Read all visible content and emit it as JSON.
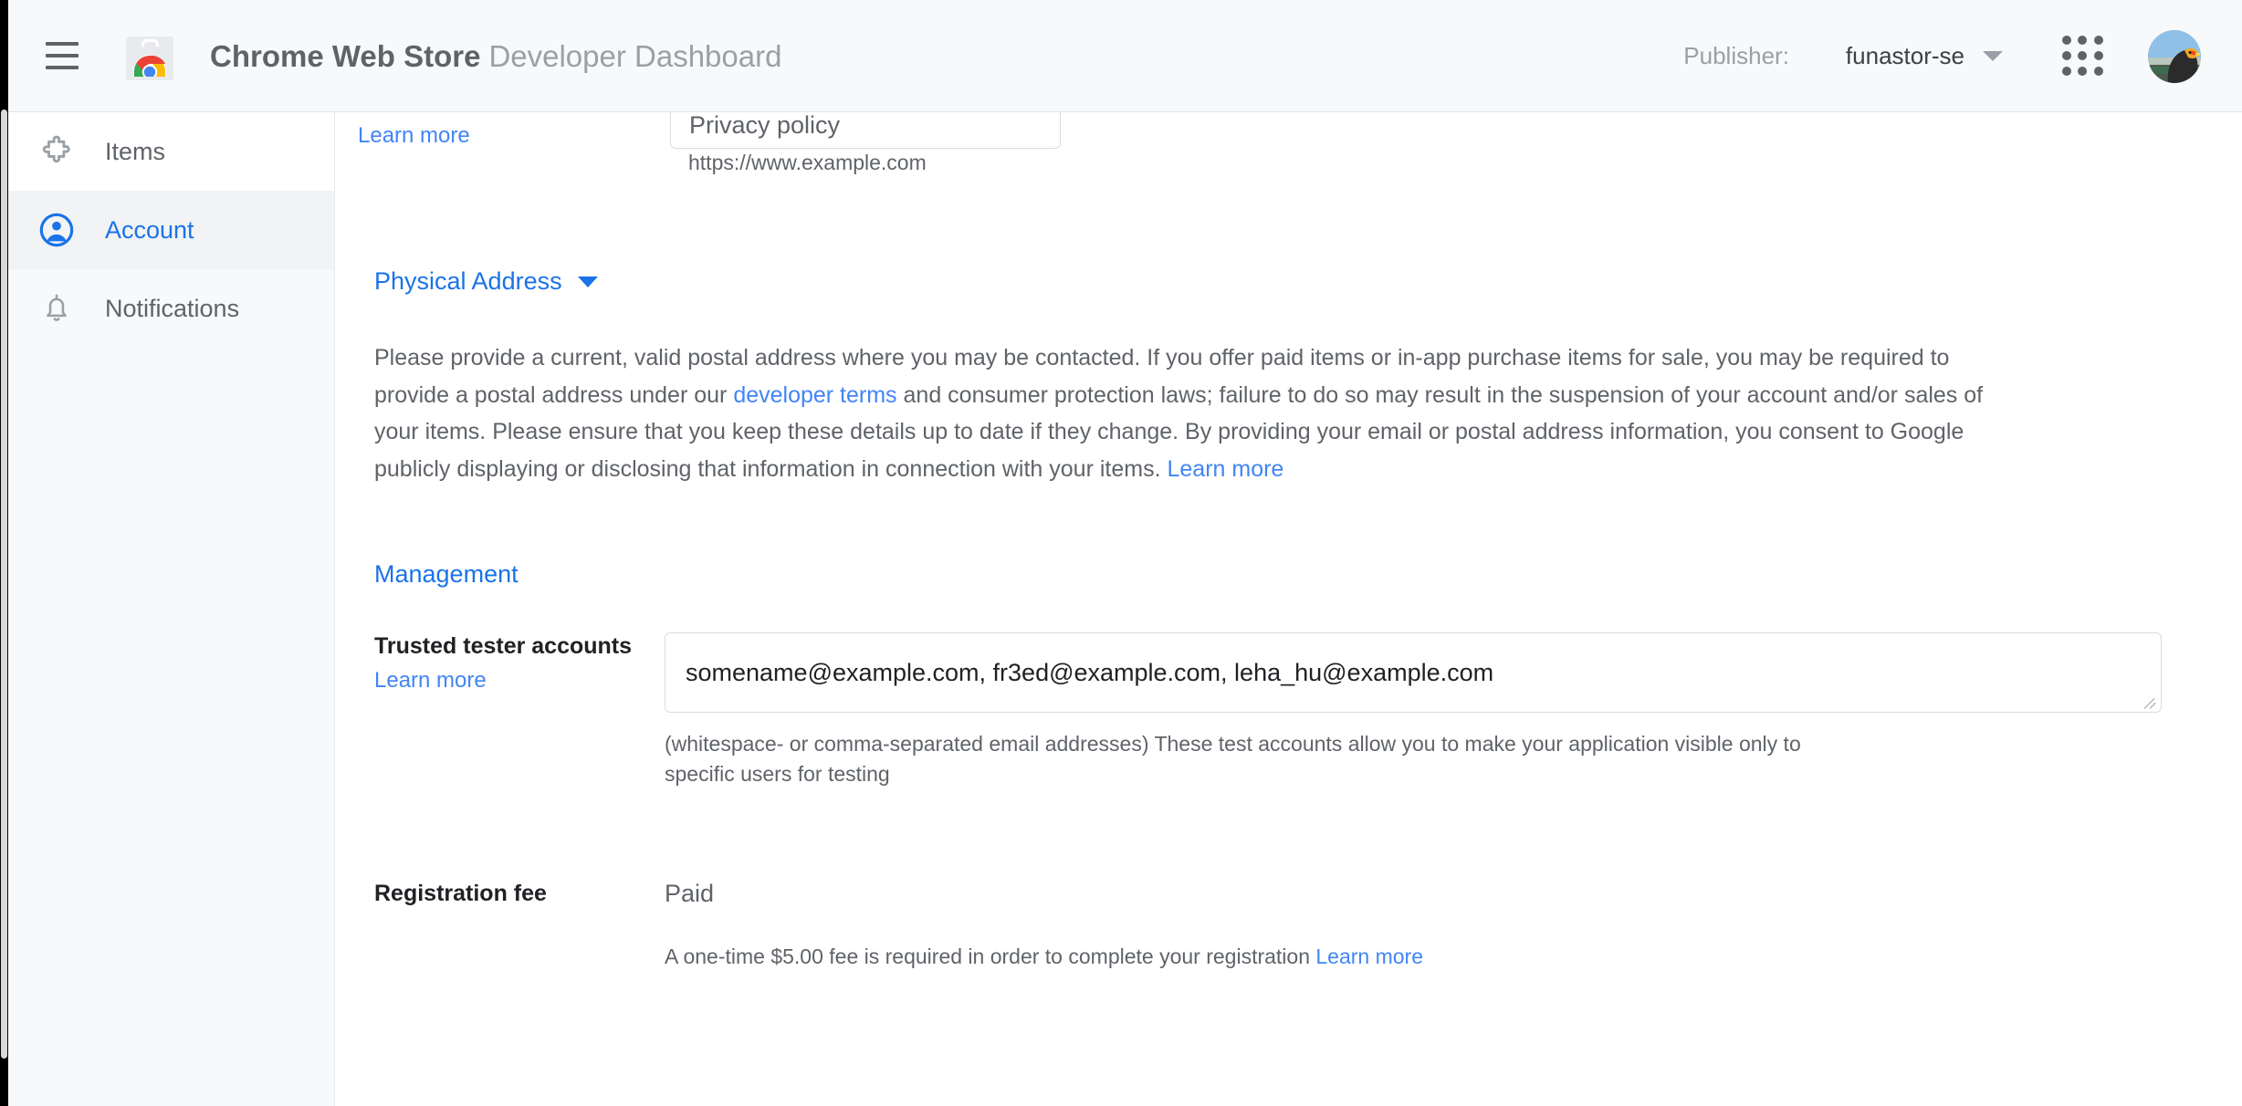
{
  "header": {
    "menu_icon": "hamburger-menu-icon",
    "logo_icon": "chrome-web-store-logo",
    "title_strong": "Chrome Web Store",
    "title_light": "Developer Dashboard",
    "publisher_label": "Publisher:",
    "publisher_value": "funastor-se",
    "publisher_caret_icon": "chevron-down-icon",
    "apps_icon": "google-apps-grid-icon",
    "avatar_icon": "user-avatar-photo"
  },
  "sidebar": {
    "items": [
      {
        "label": "Items",
        "icon": "puzzle-piece-icon",
        "active": false
      },
      {
        "label": "Account",
        "icon": "account-circle-icon",
        "active": true
      },
      {
        "label": "Notifications",
        "icon": "bell-icon",
        "active": false
      }
    ]
  },
  "main": {
    "privacy": {
      "learn_more": "Learn more",
      "field_label": "Privacy policy",
      "field_value": "",
      "hint": "https://www.example.com"
    },
    "physical_address": {
      "heading": "Physical Address",
      "caret_icon": "triangle-down-icon",
      "paragraph_part1": "Please provide a current, valid postal address where you may be contacted. If you offer paid items or in-app purchase items for sale, you may be required to provide a postal address under our ",
      "paragraph_link": "developer terms",
      "paragraph_part2": " and consumer protection laws; failure to do so may result in the suspension of your account and/or sales of your items. Please ensure that you keep these details up to date if they change. By providing your email or postal address information, you consent to Google publicly displaying or disclosing that information in connection with your items. ",
      "paragraph_learn_more": "Learn more"
    },
    "management": {
      "heading": "Management",
      "trusted_testers": {
        "label": "Trusted tester accounts",
        "learn_more": "Learn more",
        "value": "somename@example.com, fr3ed@example.com, leha_hu@example.com",
        "placeholder": "",
        "helper": "(whitespace- or comma-separated email addresses) These test accounts allow you to make your application visible only to specific users for testing",
        "resize_icon": "resize-handle-icon"
      },
      "registration_fee": {
        "label": "Registration fee",
        "value": "Paid",
        "note_text": "A one-time $5.00 fee is required in order to complete your registration ",
        "note_link": "Learn more"
      }
    }
  },
  "colors": {
    "accent_blue": "#4285f4",
    "link_blue": "#1a73e8",
    "text_gray": "#5f6368",
    "text_dark": "#202124",
    "appbar_bg": "#f8f9fa",
    "sidebar_bg": "#f8f9fa",
    "active_bg": "#f1f3f4"
  }
}
